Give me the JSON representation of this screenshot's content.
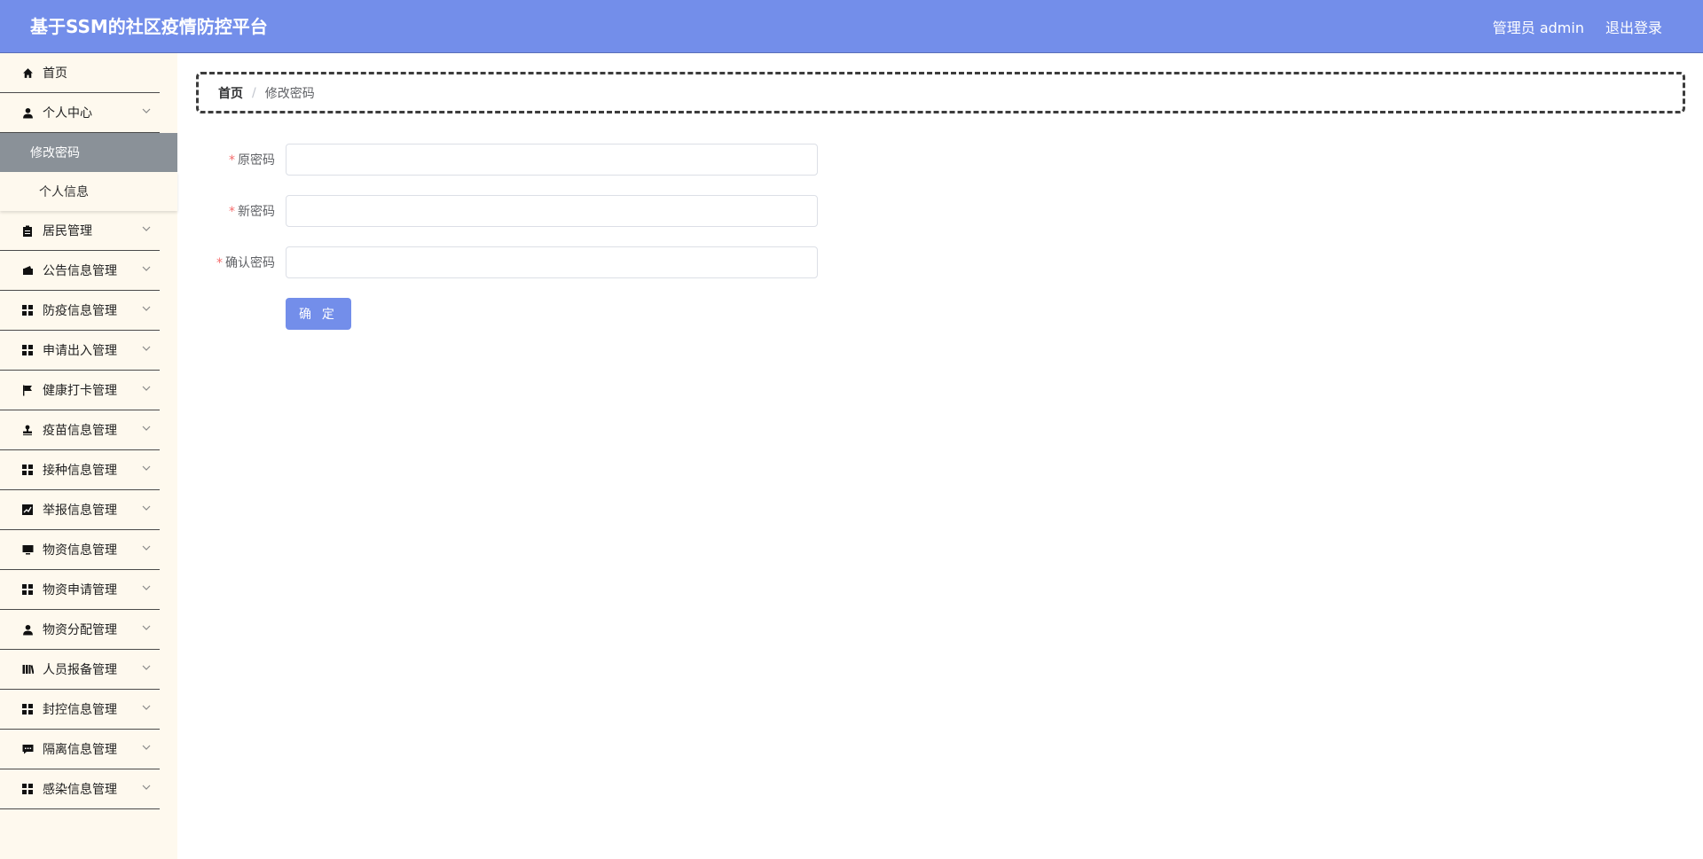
{
  "header": {
    "title": "基于SSM的社区疫情防控平台",
    "user": "管理员 admin",
    "logout": "退出登录",
    "bg_color": "#738eea"
  },
  "sidebar": {
    "items": [
      {
        "label": "首页",
        "icon": "home-icon"
      },
      {
        "label": "个人中心",
        "icon": "user-icon",
        "expanded": true,
        "children": [
          {
            "label": "修改密码",
            "active": true
          },
          {
            "label": "个人信息"
          }
        ]
      },
      {
        "label": "居民管理",
        "icon": "clipboard-icon"
      },
      {
        "label": "公告信息管理",
        "icon": "wallet-icon"
      },
      {
        "label": "防疫信息管理",
        "icon": "grid-icon"
      },
      {
        "label": "申请出入管理",
        "icon": "grid-icon"
      },
      {
        "label": "健康打卡管理",
        "icon": "flag-icon"
      },
      {
        "label": "疫苗信息管理",
        "icon": "stamp-icon"
      },
      {
        "label": "接种信息管理",
        "icon": "grid-icon"
      },
      {
        "label": "举报信息管理",
        "icon": "chart-icon"
      },
      {
        "label": "物资信息管理",
        "icon": "monitor-icon"
      },
      {
        "label": "物资申请管理",
        "icon": "grid-icon"
      },
      {
        "label": "物资分配管理",
        "icon": "person-icon"
      },
      {
        "label": "人员报备管理",
        "icon": "books-icon"
      },
      {
        "label": "封控信息管理",
        "icon": "grid-icon"
      },
      {
        "label": "隔离信息管理",
        "icon": "comment-icon"
      },
      {
        "label": "感染信息管理",
        "icon": "grid-icon"
      }
    ]
  },
  "breadcrumb": {
    "home": "首页",
    "separator": "/",
    "current": "修改密码"
  },
  "form": {
    "fields": [
      {
        "label": "原密码",
        "required": true,
        "value": ""
      },
      {
        "label": "新密码",
        "required": true,
        "value": ""
      },
      {
        "label": "确认密码",
        "required": true,
        "value": ""
      }
    ],
    "submit": "确 定"
  }
}
